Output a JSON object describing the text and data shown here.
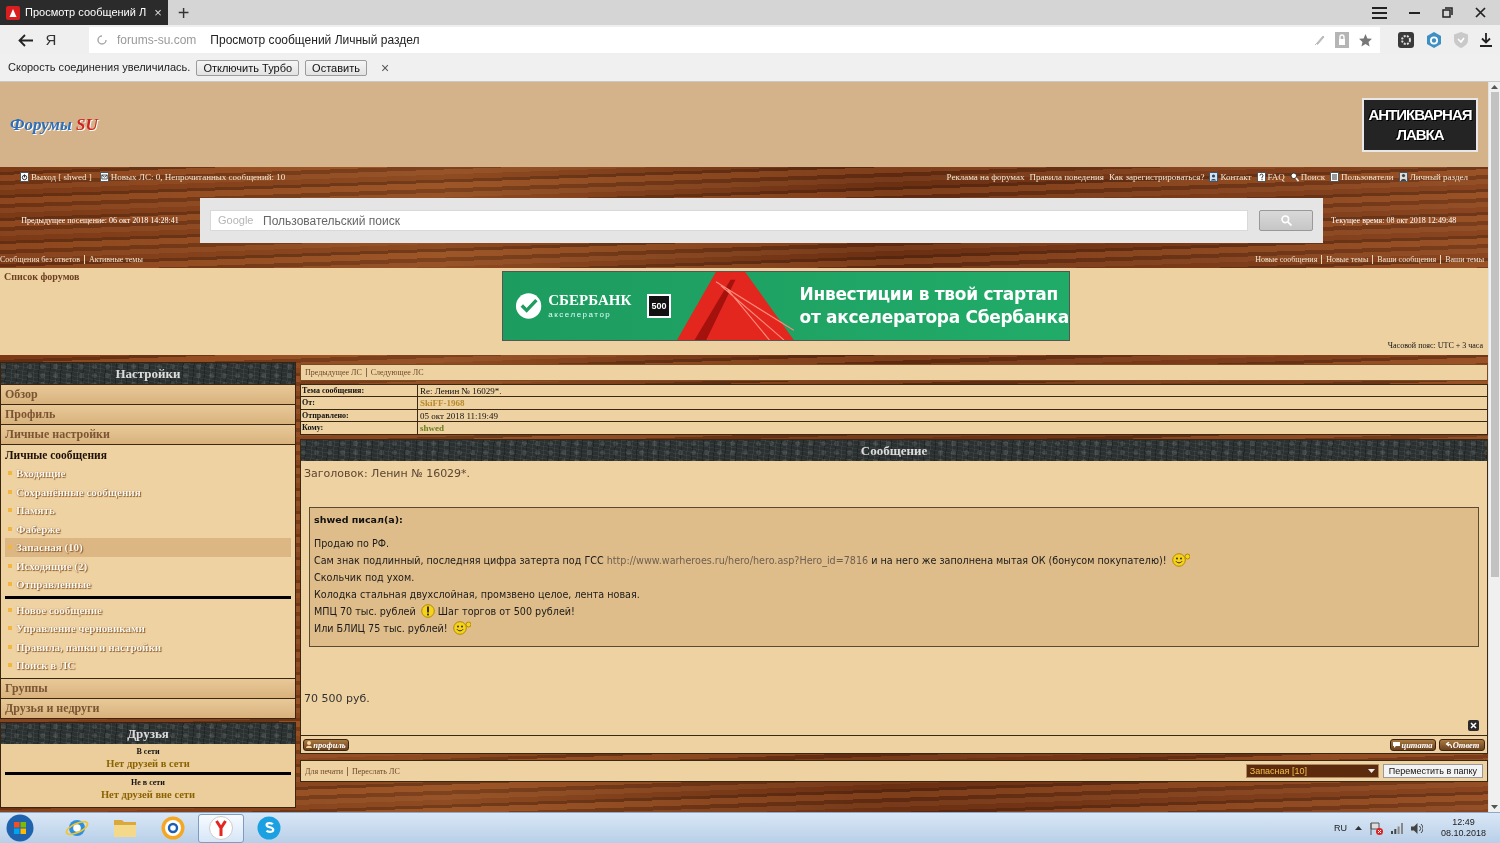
{
  "browser": {
    "tab": {
      "title": "Просмотр сообщений Л",
      "close": "×"
    },
    "new_tab": "+",
    "logo_button": "Я",
    "address": {
      "domain": "forums-su.com",
      "title": "Просмотр сообщений Личный раздел"
    }
  },
  "turbo_bar": {
    "message": "Скорость соединения увеличилась.",
    "buttons": [
      "Отключить Турбо",
      "Оставить"
    ],
    "close": "×"
  },
  "header": {
    "logo": {
      "name": "Форумы",
      "suffix": "SU"
    },
    "shop_logo": [
      "АНТИКВАРНАЯ",
      "ЛАВКА"
    ]
  },
  "top_nav": {
    "left": [
      {
        "kind": "power",
        "label": "Выход [ shwed ]"
      },
      {
        "kind": "mail",
        "label": "Новых ЛС: 0, Непрочитанных сообщений: 10"
      }
    ],
    "right": [
      {
        "kind": "plain",
        "label": "Реклама на форумах"
      },
      {
        "kind": "plain",
        "label": "Правила поведения"
      },
      {
        "kind": "plain",
        "label": "Как зарегистрироваться?"
      },
      {
        "kind": "contact",
        "label": "Контакт"
      },
      {
        "kind": "help",
        "label": "FAQ"
      },
      {
        "kind": "search",
        "label": "Поиск"
      },
      {
        "kind": "users",
        "label": "Пользователи"
      },
      {
        "kind": "person",
        "label": "Личный раздел"
      }
    ]
  },
  "search": {
    "previous_visit": "Предыдущее посещение: 06 окт 2018 14:28:41",
    "brand": "Google",
    "placeholder": "Пользовательский поиск",
    "current_time": "Текущее время: 08 окт 2018 12:49:48"
  },
  "quick_links": {
    "left": [
      "Сообщения без ответов",
      "Активные темы"
    ],
    "right": [
      "Новые сообщения",
      "Новые темы",
      "Ваши сообщения",
      "Ваши темы"
    ]
  },
  "breadcrumb": "Список форумов",
  "banner": {
    "brand": "СБЕРБАНК",
    "subtitle": "акселератор",
    "badge": "500",
    "headline": [
      "Инвестиции в твой стартап",
      "от акселератора Сбербанка"
    ]
  },
  "timezone": "Часовой пояс: UTC + 3 часа",
  "sidebar": {
    "title": "Настройки",
    "sections": [
      {
        "label": "Обзор",
        "expanded": false
      },
      {
        "label": "Профиль",
        "expanded": false
      },
      {
        "label": "Личные настройки",
        "expanded": false
      },
      {
        "label": "Личные сообщения",
        "expanded": true,
        "folders": [
          {
            "label": "Входящие",
            "selected": false
          },
          {
            "label": "Сохранённые сообщения",
            "selected": false
          },
          {
            "label": "Память",
            "selected": false
          },
          {
            "label": "Фаберже",
            "selected": false
          },
          {
            "label": "Запасная (10)",
            "selected": true
          },
          {
            "label": "Исходящие (2)",
            "selected": false
          },
          {
            "label": "Отправленные",
            "selected": false
          }
        ],
        "actions": [
          "Новое сообщение",
          "Управление черновиками",
          "Правила, папки и настройки",
          "Поиск в ЛС"
        ]
      },
      {
        "label": "Группы",
        "expanded": false
      },
      {
        "label": "Друзья и недруги",
        "expanded": false
      }
    ]
  },
  "friends": {
    "title": "Друзья",
    "groups": [
      {
        "heading": "В сети",
        "empty": "Нет друзей в сети"
      },
      {
        "heading": "Не в сети",
        "empty": "Нет друзей вне сети"
      }
    ]
  },
  "message_nav": [
    "Предыдущее ЛС",
    "Следующее ЛС"
  ],
  "details": [
    {
      "label": "Тема сообщения:",
      "value": "Re: Ленин № 16029*."
    },
    {
      "label": "От:",
      "value": "SkiFF-1968",
      "color": "#b58a2c"
    },
    {
      "label": "Отправлено:",
      "value": "05 окт 2018 11:19:49"
    },
    {
      "label": "Кому:",
      "value": "shwed",
      "color": "#6a7d1f"
    }
  ],
  "message": {
    "heading": "Сообщение",
    "subject": "Заголовок: Ленин № 16029*.",
    "quote": {
      "author": "shwed писал(а):",
      "lines": [
        [
          {
            "kind": "text",
            "text": "Продаю по РФ."
          }
        ],
        [
          {
            "kind": "text",
            "text": "Сам знак подлинный, последняя цифра затерта под ГСС "
          },
          {
            "kind": "link",
            "text": "http://www.warheroes.ru/hero/hero.asp?Hero_id=7816"
          },
          {
            "kind": "text",
            "text": " и на него же заполнена мытая ОК (бонусом покупателю)! "
          },
          {
            "kind": "smile"
          }
        ],
        [
          {
            "kind": "text",
            "text": "Скольчик под ухом."
          }
        ],
        [
          {
            "kind": "text",
            "text": "Колодка стальная двухслойная, промзвено целое, лента новая."
          }
        ],
        [
          {
            "kind": "text",
            "text": "МПЦ 70 тыс. рублей "
          },
          {
            "kind": "alert"
          },
          {
            "kind": "text",
            "text": " Шаг торгов от 500 рублей!"
          }
        ],
        [
          {
            "kind": "text",
            "text": "Или БЛИЦ 75 тыс. рублей! "
          },
          {
            "kind": "smile"
          }
        ]
      ]
    },
    "price": "70 500 руб."
  },
  "post_actions": {
    "profile": "профиль",
    "quote": "цитата",
    "reply": "Ответ"
  },
  "footer": {
    "links": [
      "Для печати",
      "Переслать ЛС"
    ],
    "folder": "Запасная [10]",
    "move_button": "Переместить в папку"
  },
  "taskbar": {
    "apps": [
      {
        "kind": "globe",
        "selected": false
      },
      {
        "kind": "folder",
        "selected": false
      },
      {
        "kind": "ring",
        "selected": false
      },
      {
        "kind": "browser",
        "selected": true
      },
      {
        "kind": "chat",
        "selected": false
      }
    ],
    "language": "RU",
    "time": "12:49",
    "date": "08.10.2018"
  }
}
